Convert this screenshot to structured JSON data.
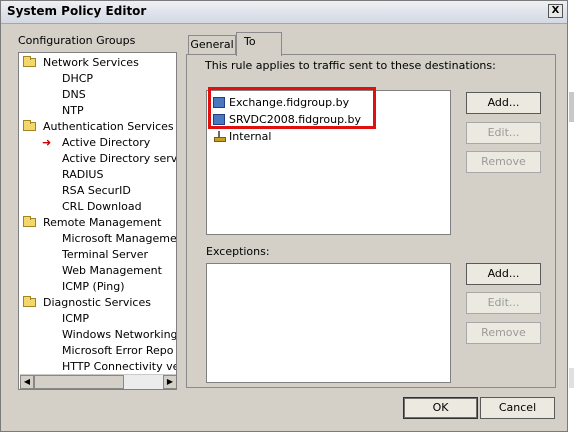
{
  "window": {
    "title": "System Policy Editor",
    "close_glyph": "X"
  },
  "sidebar": {
    "label": "Configuration Groups",
    "items": [
      {
        "label": "Network Services",
        "icon": "folder-icon"
      },
      {
        "label": "DHCP"
      },
      {
        "label": "DNS"
      },
      {
        "label": "NTP"
      },
      {
        "label": "Authentication Services",
        "icon": "folder-icon"
      },
      {
        "label": "Active Directory",
        "icon": "selected-arrow-icon"
      },
      {
        "label": "Active Directory serv"
      },
      {
        "label": "RADIUS"
      },
      {
        "label": "RSA SecurID"
      },
      {
        "label": "CRL Download"
      },
      {
        "label": "Remote Management",
        "icon": "folder-icon"
      },
      {
        "label": "Microsoft Manageme"
      },
      {
        "label": "Terminal Server"
      },
      {
        "label": "Web Management"
      },
      {
        "label": "ICMP (Ping)"
      },
      {
        "label": "Diagnostic Services",
        "icon": "folder-icon"
      },
      {
        "label": "ICMP"
      },
      {
        "label": "Windows Networking"
      },
      {
        "label": "Microsoft Error Repo"
      },
      {
        "label": "HTTP Connectivity ve"
      }
    ]
  },
  "tabs": [
    {
      "label": "General",
      "active": false
    },
    {
      "label": "To",
      "active": true
    }
  ],
  "to_tab": {
    "description": "This rule applies to traffic sent to these destinations:",
    "destinations": [
      {
        "label": "Exchange.fidgroup.by",
        "icon": "server-icon"
      },
      {
        "label": "SRVDC2008.fidgroup.by",
        "icon": "server-icon"
      },
      {
        "label": "Internal",
        "icon": "network-icon"
      }
    ],
    "destination_buttons": {
      "add": "Add...",
      "edit": "Edit...",
      "remove": "Remove"
    },
    "exceptions_label": "Exceptions:",
    "exceptions": [],
    "exception_buttons": {
      "add": "Add...",
      "edit": "Edit...",
      "remove": "Remove"
    }
  },
  "footer": {
    "ok": "OK",
    "cancel": "Cancel"
  },
  "colors": {
    "highlight": "#e01010",
    "dialog_bg": "#d4d0c8"
  }
}
